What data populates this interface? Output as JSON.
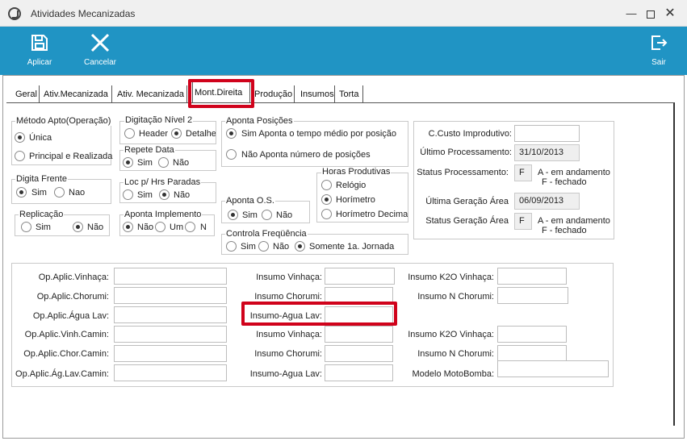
{
  "window": {
    "title": "Atividades Mecanizadas"
  },
  "toolbar": {
    "apply_label": "Aplicar",
    "cancel_label": "Cancelar",
    "exit_label": "Sair"
  },
  "tabs": [
    "Geral",
    "Ativ.Mecanizada",
    "Ativ. Mecanizada",
    "Mont.Direita",
    "Produção",
    "Insumos",
    "Torta"
  ],
  "active_tab": "Mont.Direita",
  "metodo": {
    "title": "Método Apto(Operação)",
    "opt1": "Única",
    "opt2": "Principal e Realizada",
    "selected": "Única"
  },
  "digitacao": {
    "title": "Digitação Nível 2",
    "opt1": "Header",
    "opt2": "Detalhe",
    "selected": "Detalhe"
  },
  "repete": {
    "title": "Repete Data",
    "opt1": "Sim",
    "opt2": "Não",
    "selected": "Sim"
  },
  "aponta_pos": {
    "title": "Aponta Posições",
    "opt1": "Sim  Aponta o tempo médio por posição",
    "opt2": "Não  Aponta número de posições",
    "selected": "Sim"
  },
  "digita_frente": {
    "title": "Digita Frente",
    "opt1": "Sim",
    "opt2": "Nao",
    "selected": "Sim"
  },
  "loc_hrs": {
    "title": "Loc p/ Hrs Paradas",
    "opt1": "Sim",
    "opt2": "Não",
    "selected": "Não"
  },
  "horas_prod": {
    "title": "Horas Produtivas",
    "opt1": "Relógio",
    "opt2": "Horímetro",
    "opt3": "Horímetro Decimal",
    "selected": "Horímetro"
  },
  "aponta_os": {
    "title": "Aponta O.S.",
    "opt1": "Sim",
    "opt2": "Não",
    "selected": "Sim"
  },
  "replicacao": {
    "title": "Replicação",
    "opt1": "Sim",
    "opt2": "Não",
    "selected": "Não"
  },
  "aponta_impl": {
    "title": "Aponta Implemento",
    "opt1": "Não",
    "opt2": "Um",
    "opt3": "N",
    "selected": "Não"
  },
  "controla_freq": {
    "title": "Controla Freqüência",
    "opt1": "Sim",
    "opt2": "Não",
    "opt3": "Somente 1a. Jornada",
    "selected": "Somente 1a. Jornada"
  },
  "status": {
    "ccusto_label": "C.Custo Improdutivo:",
    "ccusto_value": "",
    "ult_proc_label": "Último Processamento:",
    "ult_proc_value": "31/10/2013",
    "status_proc_label": "Status Processamento:",
    "status_proc_value": "F",
    "legend_a": "A - em andamento",
    "legend_f": "F - fechado",
    "ult_ger_label": "Última Geração Área",
    "ult_ger_value": "06/09/2013",
    "status_ger_label": "Status Geração Área",
    "status_ger_value": "F"
  },
  "ops": {
    "col1": [
      "Op.Aplic.Vinhaça:",
      "Op.Aplic.Chorumi:",
      "Op.Aplic.Água Lav:",
      "Op.Aplic.Vinh.Camin:",
      "Op.Aplic.Chor.Camin:",
      "Op.Aplic.Ág.Lav.Camin:"
    ],
    "col2": [
      "Insumo Vinhaça:",
      "Insumo Chorumi:",
      "Insumo-Agua Lav:",
      "Insumo Vinhaça:",
      "Insumo Chorumi:",
      "Insumo-Agua Lav:"
    ],
    "col3": [
      "Insumo K2O Vinhaça:",
      "Insumo N Chorumi:",
      "Insumo K2O Vinhaça:",
      "Insumo N Chorumi:",
      "Modelo MotoBomba:"
    ]
  },
  "colors": {
    "toolbar": "#2094c4",
    "highlight": "#d0021b"
  }
}
